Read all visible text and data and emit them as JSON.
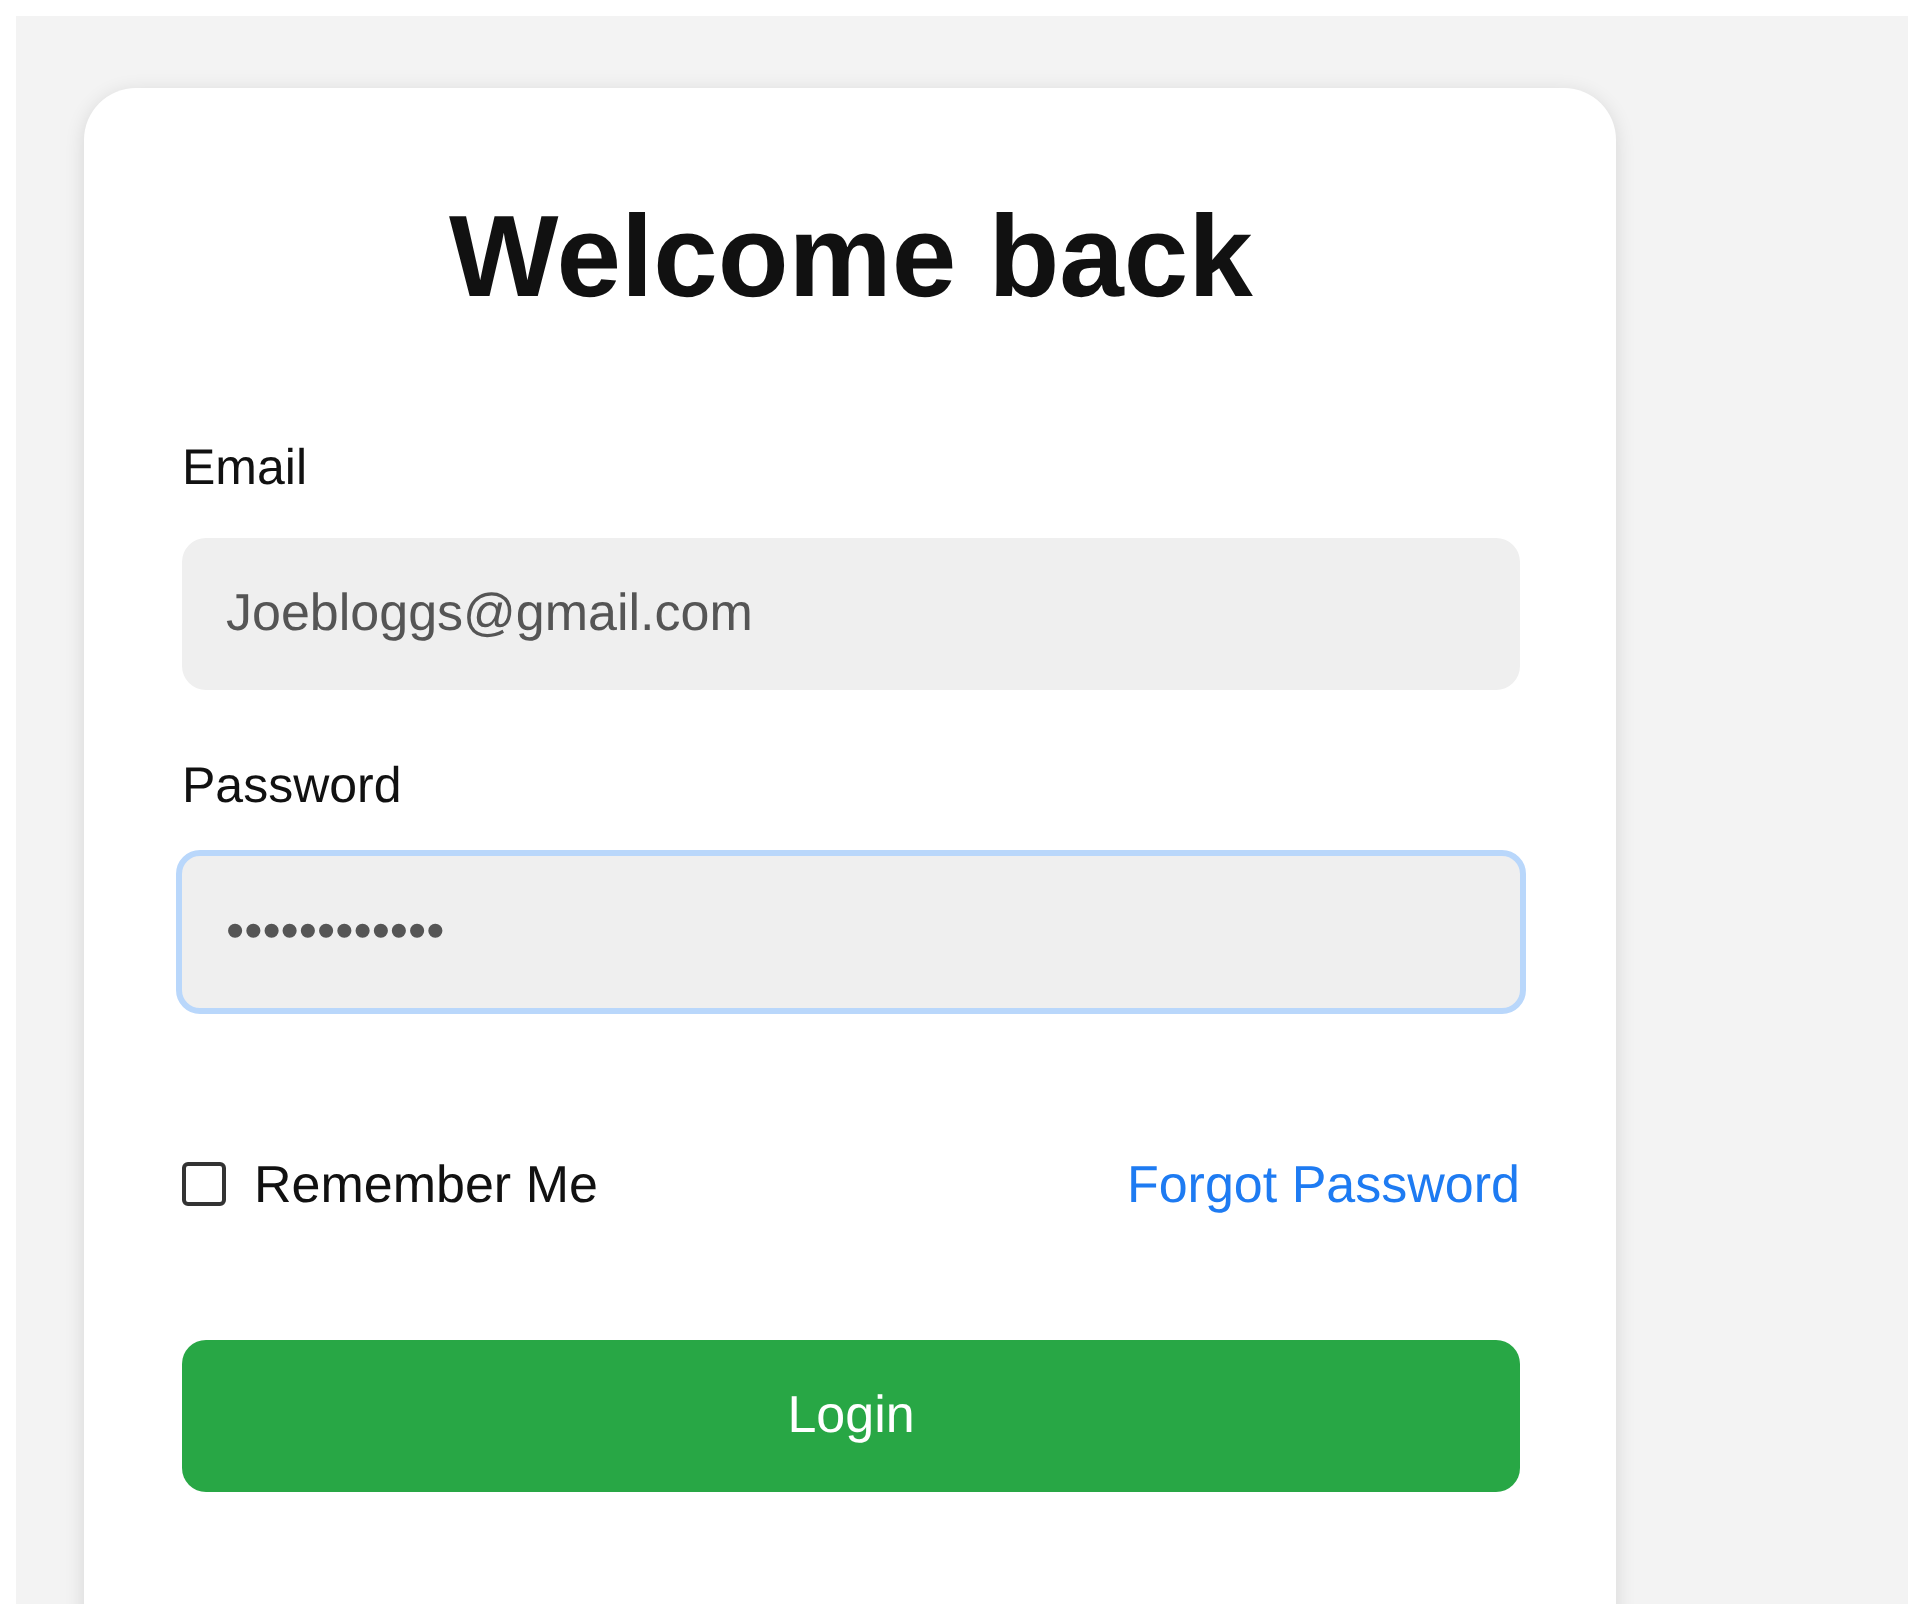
{
  "title": "Welcome back",
  "fields": [
    {
      "label": "Email",
      "value": "Joebloggs@gmail.com",
      "focused": false
    },
    {
      "label": "Password",
      "value": "••••••••••••",
      "focused": true
    }
  ],
  "remember": {
    "label": "Remember Me",
    "checked": false
  },
  "forgot_link": "Forgot Password",
  "login_button": "Login"
}
